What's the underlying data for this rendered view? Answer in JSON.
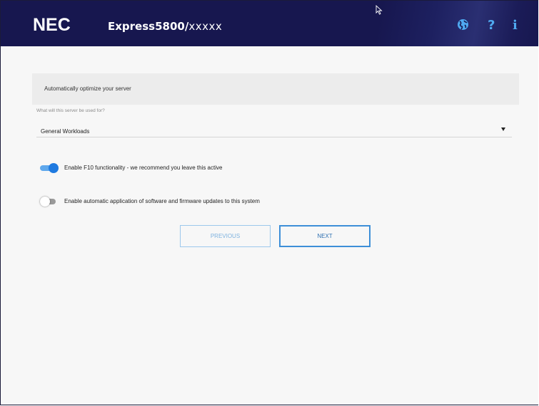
{
  "header": {
    "brand": "NEC",
    "product_name": "Express5800/",
    "product_suffix": "xxxxx",
    "icons": [
      "globe-icon",
      "help-icon",
      "info-icon"
    ],
    "help_glyph": "?",
    "info_glyph": "i"
  },
  "optimize": {
    "heading": "Automatically optimize your server",
    "usage_label": "What will this server be used for?",
    "usage_value": "General Workloads"
  },
  "toggles": {
    "f10": {
      "label": "Enable F10 functionality - we recommend you leave this active",
      "enabled": true
    },
    "auto_updates": {
      "label": "Enable automatic application of software and firmware updates to this system",
      "enabled": false
    }
  },
  "buttons": {
    "previous": "PREVIOUS",
    "next": "NEXT"
  },
  "colors": {
    "header_bg": "#17174f",
    "accent": "#1f7ae0",
    "icon": "#4fa9f0"
  }
}
